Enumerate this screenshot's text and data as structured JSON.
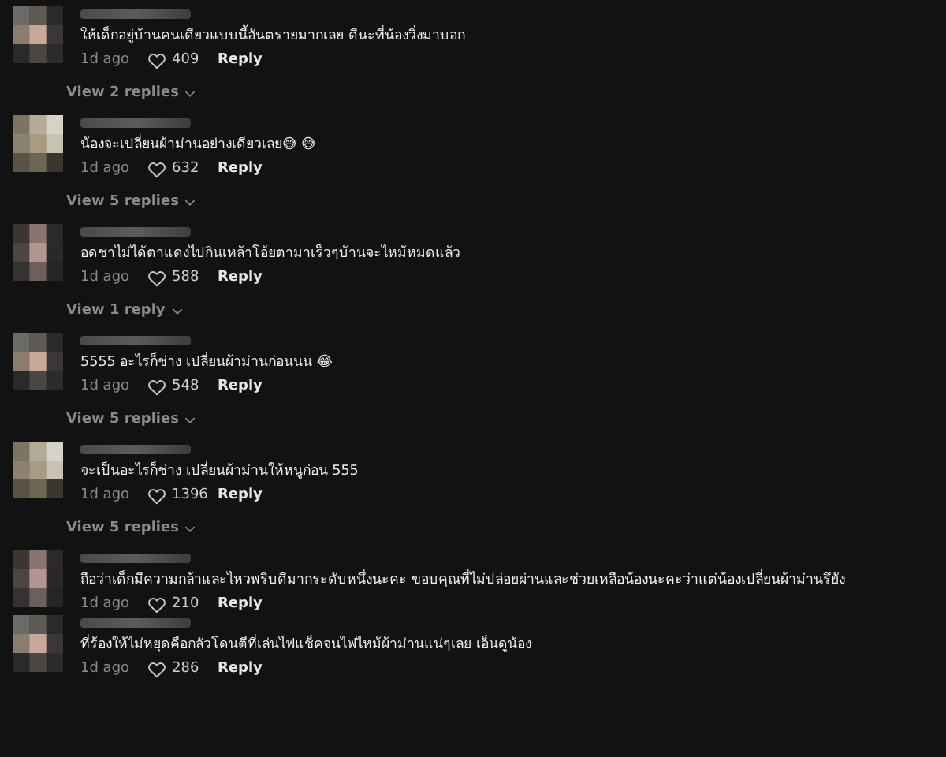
{
  "comments": [
    {
      "text": "ให้เด็กอยู่บ้านคนเดียวแบบนี้อันตรายมากเลย ดีนะที่น้องวิ่งมาบอก",
      "time": "1d ago",
      "likes": "409",
      "reply": "Reply",
      "view_replies": "View 2 replies"
    },
    {
      "text": "น้องจะเปลี่ยนผ้าม่านอย่างเดียวเลย😅 😅",
      "time": "1d ago",
      "likes": "632",
      "reply": "Reply",
      "view_replies": "View 5 replies"
    },
    {
      "text": "อดชาไม่ได้ตาแดงไปกินเหล้าโอ้ยตามาเร็วๆบ้านจะไหม้หมดแล้ว",
      "time": "1d ago",
      "likes": "588",
      "reply": "Reply",
      "view_replies": "View 1 reply"
    },
    {
      "text": "5555 อะไรก็ช่าง เปลี่ยนผ้าม่านก่อนนน 😂",
      "time": "1d ago",
      "likes": "548",
      "reply": "Reply",
      "view_replies": "View 5 replies"
    },
    {
      "text": "จะเป็นอะไรก็ช่าง เปลี่ยนผ้าม่านให้หนูก่อน 555",
      "time": "1d ago",
      "likes": "1396",
      "reply": "Reply",
      "view_replies": "View 5 replies"
    },
    {
      "text": "ถือว่าเด็กมีความกล้าและไหวพริบดีมากระดับหนึ่งนะคะ ขอบคุณที่ไม่ปล่อยผ่านและช่วยเหลือน้องนะคะว่าแต่น้องเปลี่ยนผ้าม่านรึยัง",
      "time": "1d ago",
      "likes": "210",
      "reply": "Reply"
    },
    {
      "text": "ที่ร้องให้ไม่หยุดคือกลัวโดนตีที่เล่นไฟแช็คจนไฟไหม้ผ้าม่านแน่ๆเลย เอ็นดูน้อง",
      "time": "1d ago",
      "likes": "286",
      "reply": "Reply"
    }
  ]
}
